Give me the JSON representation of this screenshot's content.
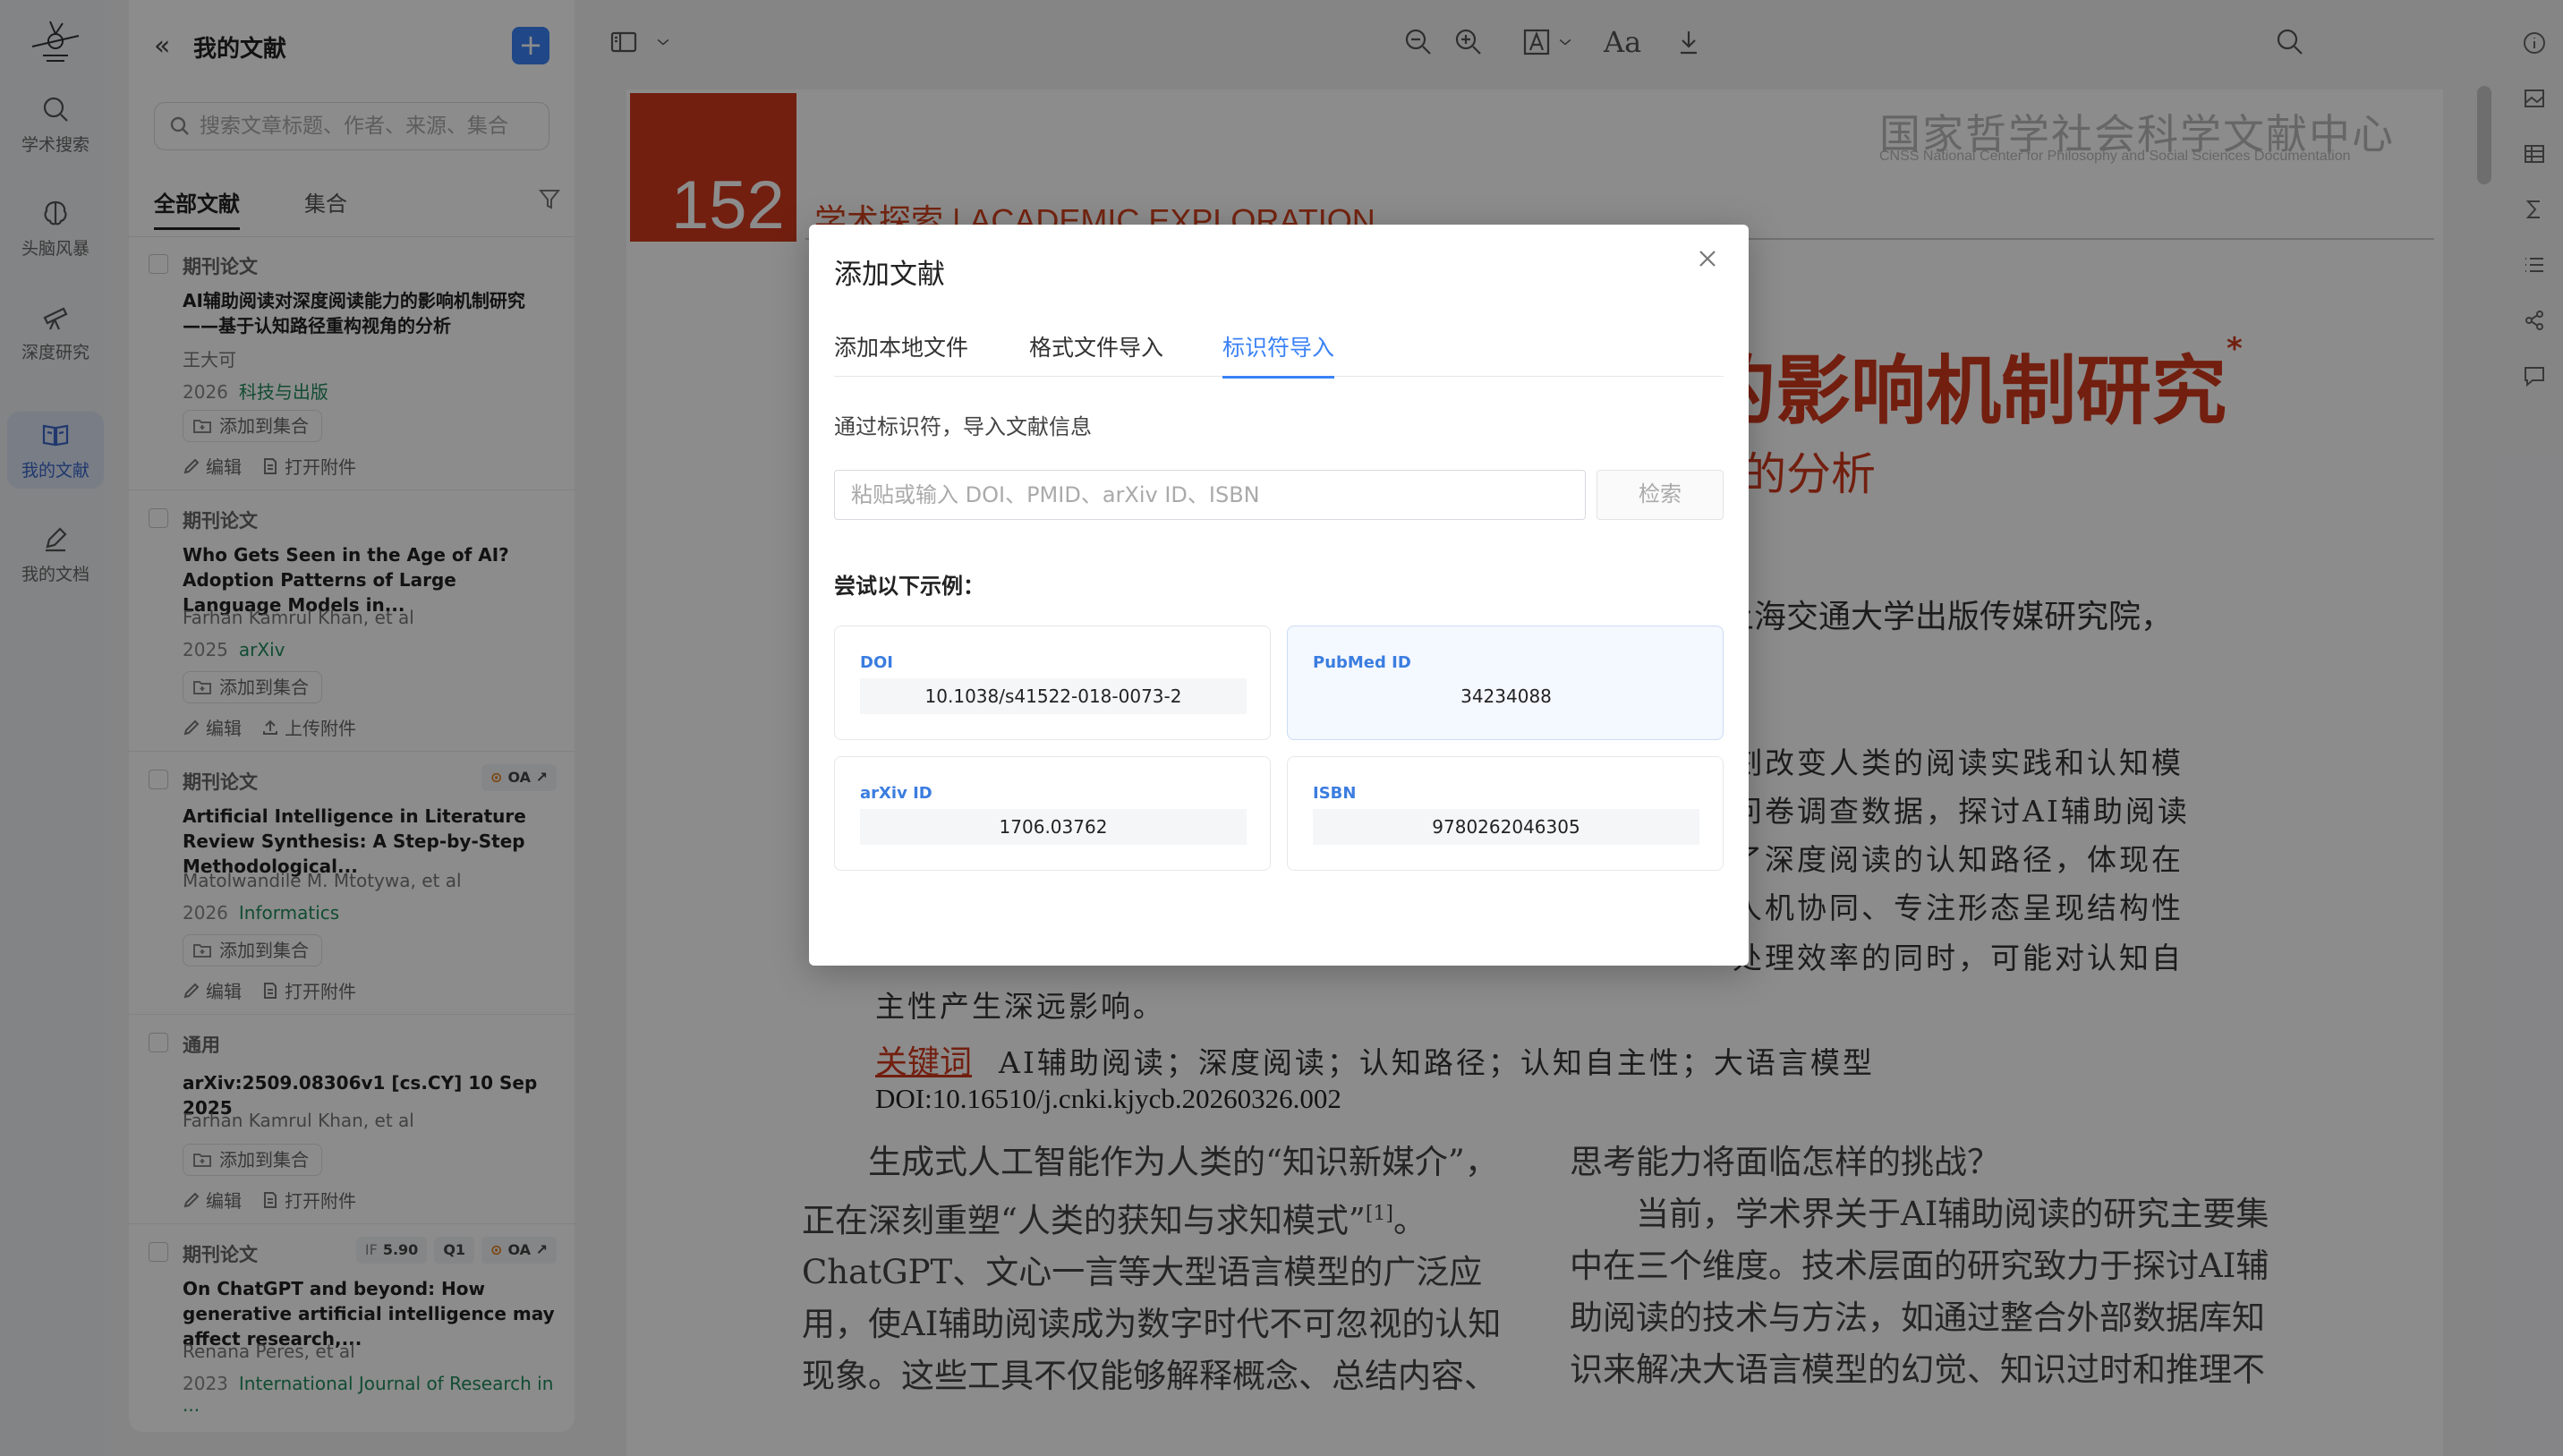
{
  "rail": {
    "items": [
      {
        "label": "学术搜索",
        "icon": "search-icon"
      },
      {
        "label": "头脑风暴",
        "icon": "brain-icon"
      },
      {
        "label": "深度研究",
        "icon": "telescope-icon"
      },
      {
        "label": "我的文献",
        "icon": "book-icon"
      },
      {
        "label": "我的文档",
        "icon": "pen-icon"
      }
    ],
    "active_index": 3
  },
  "library": {
    "title": "我的文献",
    "search_placeholder": "搜索文章标题、作者、来源、集合",
    "tabs": [
      "全部文献",
      "集合"
    ],
    "add_to_collection": "添加到集合",
    "edit": "编辑",
    "entries": [
      {
        "type": "期刊论文",
        "title": "AI辅助阅读对深度阅读能力的影响机制研究——基于认知路径重构视角的分析",
        "authors": "王大可",
        "year": "2026",
        "source": "科技与出版",
        "attach": "打开附件",
        "badges": []
      },
      {
        "type": "期刊论文",
        "title": "Who Gets Seen in the Age of AI? Adoption Patterns of Large Language Models in...",
        "authors": "Farhan Kamrul Khan, et al",
        "year": "2025",
        "source": "arXiv",
        "attach": "上传附件",
        "badges": []
      },
      {
        "type": "期刊论文",
        "title": "Artificial Intelligence in Literature Review Synthesis: A Step-by-Step Methodological...",
        "authors": "Matolwandile M. Mtotywa, et al",
        "year": "2026",
        "source": "Informatics",
        "attach": "打开附件",
        "badges": [
          "OA"
        ]
      },
      {
        "type": "通用",
        "title": "arXiv:2509.08306v1 [cs.CY] 10 Sep 2025",
        "authors": "Farhan Kamrul Khan, et al",
        "year": "",
        "source": "",
        "attach": "打开附件",
        "badges": []
      },
      {
        "type": "期刊论文",
        "title": "On ChatGPT and beyond: How generative artificial intelligence may affect research,...",
        "authors": "Renana Peres, et al",
        "year": "2023",
        "source": "International Journal of Research in ...",
        "attach": "",
        "badges": [
          "IF 5.90",
          "Q1",
          "OA"
        ]
      }
    ]
  },
  "badges": {
    "if_label": "IF",
    "if_value": "5.90",
    "q": "Q1",
    "oa": "OA"
  },
  "document": {
    "page_number": "152",
    "brand": "国家哲学社会科学文献中心",
    "brand_en": "CNSS National Center for Philosophy and Social Sciences Documentation",
    "section": "学术探索 | ACADEMIC EXPLORATION",
    "title_fragment": "的影响机制研究",
    "title_mark": "*",
    "subtitle_fragment": "的分析",
    "affiliation_fragment": "上海交通大学出版传媒研究院，",
    "abstract_lines": [
      "刻改变人类的阅读实践和认知模",
      "问卷调查数据，探讨AI辅助阅读",
      "了深度阅读的认知路径，体现在",
      "人机协同、专注形态呈现结构性",
      "处理效率的同时，可能对认知自"
    ],
    "abstract_last": "主性产生深远影响。",
    "keywords_label": "关键词",
    "keywords": "AI辅助阅读；深度阅读；认知路径；认知自主性；大语言模型",
    "doi": "DOI:10.16510/j.cnki.kjycb.20260326.002",
    "col1": [
      "　　生成式人工智能作为人类的“知识新媒介”，",
      "正在深刻重塑“人类的获知与求知模式”",
      "ChatGPT、文心一言等大型语言模型的广泛应",
      "用，使AI辅助阅读成为数字时代不可忽视的认知",
      "现象。这些工具不仅能够解释概念、总结内容、"
    ],
    "col1_ref": "[1]",
    "col1_end": "。",
    "col2": [
      "思考能力将面临怎样的挑战？",
      "　　当前，学术界关于AI辅助阅读的研究主要集",
      "中在三个维度。技术层面的研究致力于探讨AI辅",
      "助阅读的技术与方法，如通过整合外部数据库知",
      "识来解决大语言模型的幻觉、知识过时和推理不"
    ]
  },
  "toolbar": {
    "font_label": "Aa"
  },
  "modal": {
    "title": "添加文献",
    "tabs": [
      "添加本地文件",
      "格式文件导入",
      "标识符导入"
    ],
    "active_tab": 2,
    "description": "通过标识符，导入文献信息",
    "input_placeholder": "粘贴或输入 DOI、PMID、arXiv ID、ISBN",
    "input_value": "",
    "search_button": "检索",
    "examples_label": "尝试以下示例：",
    "examples": [
      {
        "label": "DOI",
        "value": "10.1038/s41522-018-0073-2"
      },
      {
        "label": "PubMed ID",
        "value": "34234088"
      },
      {
        "label": "arXiv ID",
        "value": "1706.03762"
      },
      {
        "label": "ISBN",
        "value": "9780262046305"
      }
    ]
  },
  "colors": {
    "accent": "#3b82f6",
    "doc_red": "#cf3a1e",
    "source_green": "#1f8a5b"
  }
}
